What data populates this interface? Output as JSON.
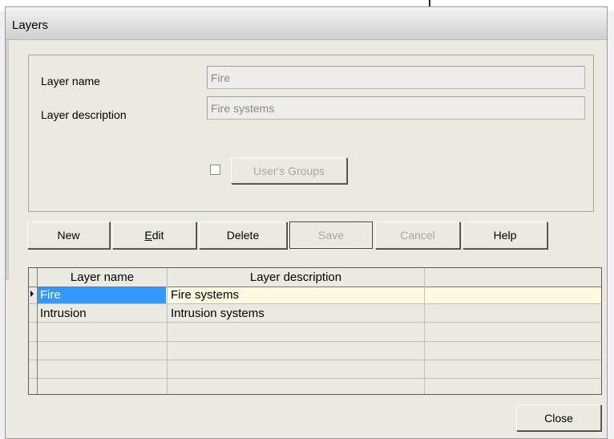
{
  "window": {
    "title": "Layers"
  },
  "form": {
    "layer_name_label": "Layer name",
    "layer_name_value": "Fire",
    "layer_description_label": "Layer description",
    "layer_description_value": "Fire systems",
    "users_groups_checked": false,
    "users_groups_button": "User's Groups"
  },
  "toolbar": {
    "new": "New",
    "edit_accel": "E",
    "edit_rest": "dit",
    "delete": "Delete",
    "save": "Save",
    "cancel": "Cancel",
    "help": "Help"
  },
  "grid": {
    "columns": [
      "Layer name",
      "Layer description",
      ""
    ],
    "rows": [
      {
        "name": "Fire",
        "description": "Fire systems",
        "selected": true
      },
      {
        "name": "Intrusion",
        "description": "Intrusion systems",
        "selected": false
      }
    ]
  },
  "footer": {
    "close": "Close"
  }
}
